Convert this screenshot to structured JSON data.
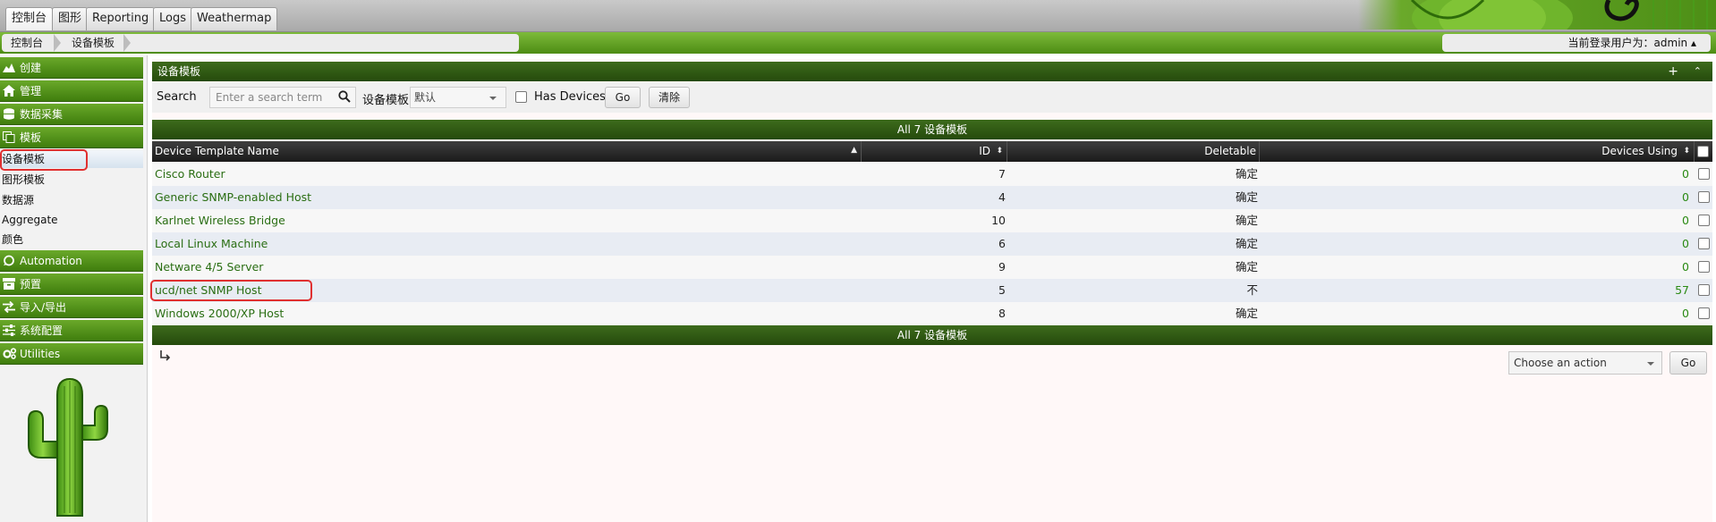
{
  "top_tabs": [
    {
      "label": "控制台",
      "active": true
    },
    {
      "label": "图形",
      "active": false
    },
    {
      "label": "Reporting",
      "active": false
    },
    {
      "label": "Logs",
      "active": false
    },
    {
      "label": "Weathermap",
      "active": false
    }
  ],
  "breadcrumb": [
    "控制台",
    "设备模板"
  ],
  "user": {
    "text": "当前登录用户为：admin ▴"
  },
  "sidebar": {
    "sections": [
      {
        "label": "创建",
        "icon": "chart-icon"
      },
      {
        "label": "管理",
        "icon": "home-icon"
      },
      {
        "label": "数据采集",
        "icon": "database-icon"
      },
      {
        "label": "模板",
        "icon": "copy-icon"
      }
    ],
    "template_items": [
      "设备模板",
      "图形模板",
      "数据源",
      "Aggregate",
      "颜色"
    ],
    "sections_after": [
      {
        "label": "Automation",
        "icon": "refresh-icon"
      },
      {
        "label": "预置",
        "icon": "archive-icon"
      },
      {
        "label": "导入/导出",
        "icon": "exchange-icon"
      },
      {
        "label": "系统配置",
        "icon": "sliders-icon"
      },
      {
        "label": "Utilities",
        "icon": "cogs-icon"
      }
    ]
  },
  "panel": {
    "title": "设备模板",
    "add_icon": "+",
    "collapse_icon": "⌃"
  },
  "filter": {
    "search_label": "Search",
    "search_placeholder": "Enter a search term",
    "template_label": "设备模板",
    "template_value": "默认",
    "has_devices_label": "Has Devices",
    "go_label": "Go",
    "clear_label": "清除"
  },
  "table": {
    "caption": "All 7 设备模板",
    "columns": [
      "Device Template Name",
      "ID",
      "Deletable",
      "Devices Using"
    ],
    "rows": [
      {
        "name": "Cisco Router",
        "id": "7",
        "deletable": "确定",
        "devices": "0"
      },
      {
        "name": "Generic SNMP-enabled Host",
        "id": "4",
        "deletable": "确定",
        "devices": "0"
      },
      {
        "name": "Karlnet Wireless Bridge",
        "id": "10",
        "deletable": "确定",
        "devices": "0"
      },
      {
        "name": "Local Linux Machine",
        "id": "6",
        "deletable": "确定",
        "devices": "0"
      },
      {
        "name": "Netware 4/5 Server",
        "id": "9",
        "deletable": "确定",
        "devices": "0"
      },
      {
        "name": "ucd/net SNMP Host",
        "id": "5",
        "deletable": "不",
        "devices": "57"
      },
      {
        "name": "Windows 2000/XP Host",
        "id": "8",
        "deletable": "确定",
        "devices": "0"
      }
    ]
  },
  "actions": {
    "select_placeholder": "Choose an action",
    "go_label": "Go"
  },
  "colors": {
    "accent_green": "#4d8c14",
    "link_green": "#2a6e13",
    "highlight_red": "#e03030"
  }
}
